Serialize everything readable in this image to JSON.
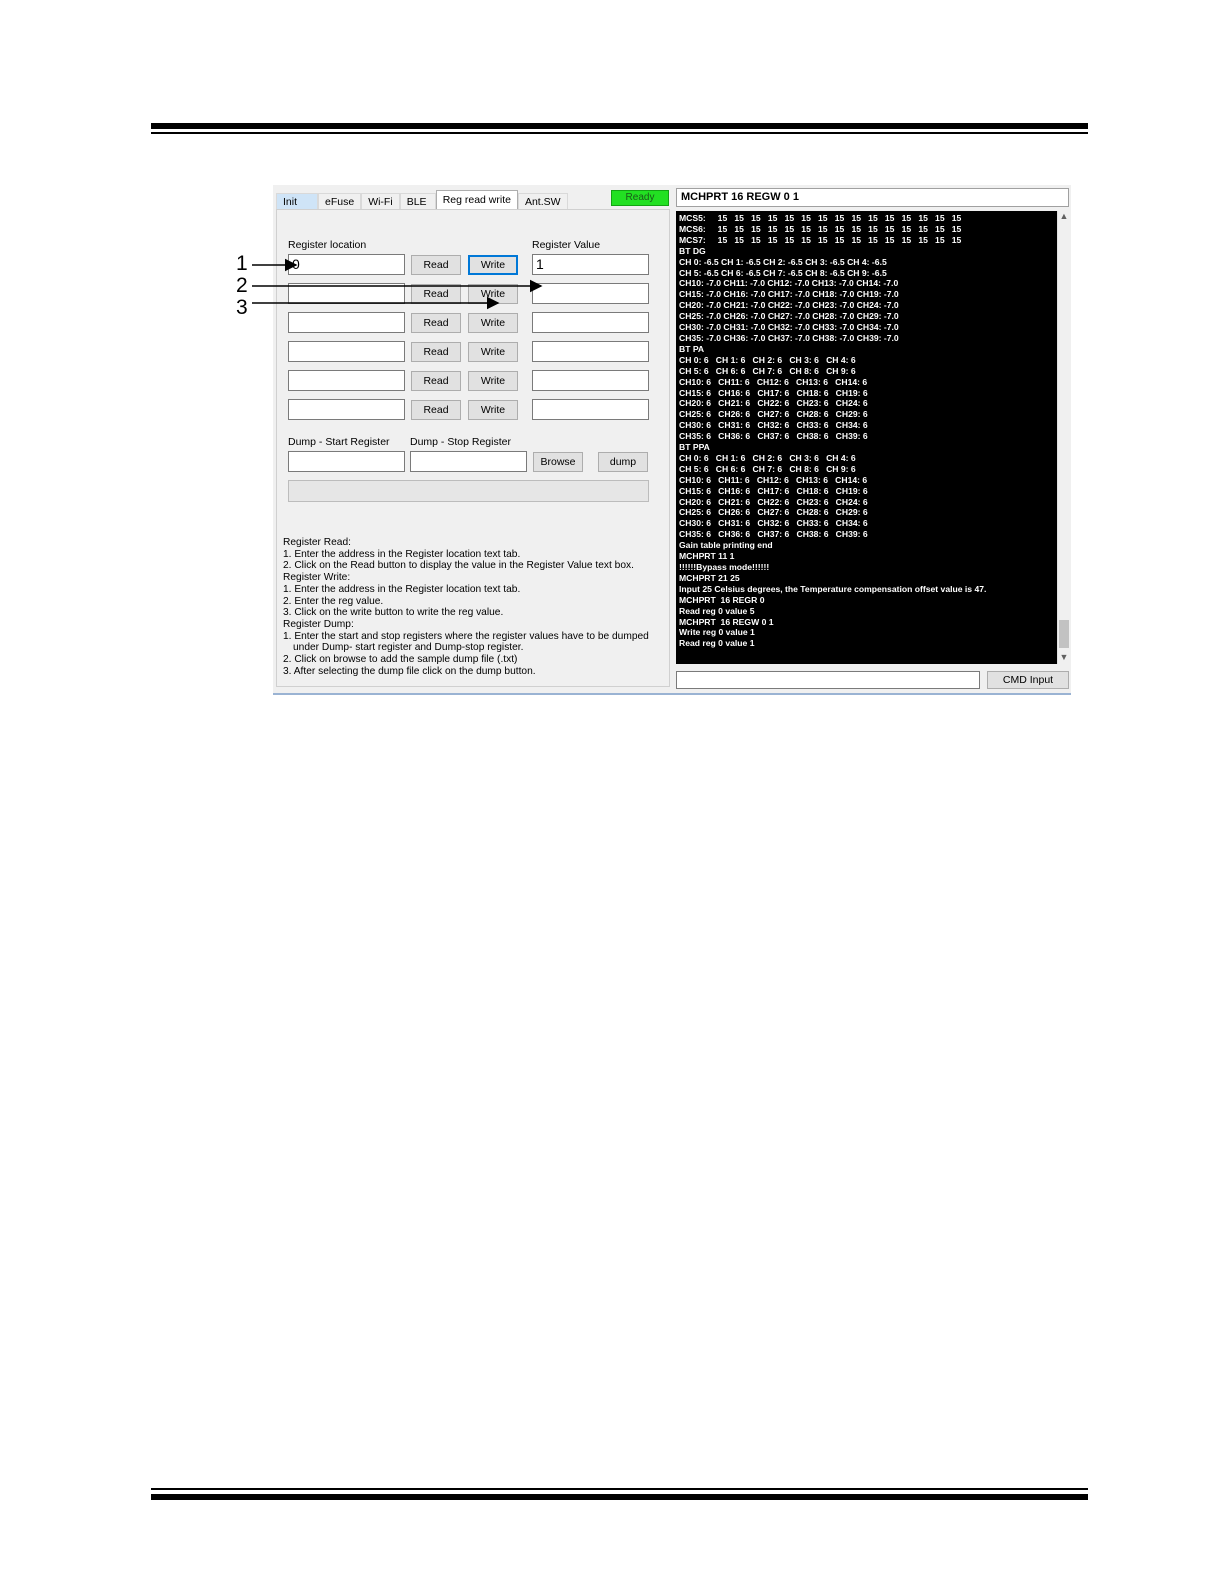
{
  "tabs": [
    "Init",
    "eFuse",
    "Wi-Fi",
    "BLE",
    "Reg read write",
    "Ant.SW"
  ],
  "status": "Ready",
  "labels": {
    "register_location": "Register location",
    "register_value": "Register Value",
    "dump_start": "Dump -  Start Register",
    "dump_stop": "Dump -  Stop Register"
  },
  "rows": [
    {
      "location": "0",
      "value": "1"
    },
    {
      "location": "",
      "value": ""
    },
    {
      "location": "",
      "value": ""
    },
    {
      "location": "",
      "value": ""
    },
    {
      "location": "",
      "value": ""
    },
    {
      "location": "",
      "value": ""
    }
  ],
  "buttons": {
    "read": "Read",
    "write": "Write",
    "browse": "Browse",
    "dump": "dump",
    "cmd_input": "CMD Input"
  },
  "help_lines": [
    "Register Read:",
    "1. Enter the address in the Register location text tab.",
    "2. Click on the Read button to display the value in the Register Value text box.",
    "Register Write:",
    "1. Enter the address in the Register location text tab.",
    "2. Enter the reg value.",
    "3. Click on the write button to write the reg value.",
    "Register Dump:",
    "1. Enter the start and stop registers where the register values have to be dumped",
    "   under Dump- start register and Dump-stop register.",
    "2.  Click on browse to add the sample dump file (.txt)",
    "3. After selecting the dump file click on the dump button."
  ],
  "command_title": "MCHPRT  16 REGW 0 1",
  "console_lines": [
    "MCS5:     15   15   15   15   15   15   15   15   15   15   15   15   15   15   15",
    "MCS6:     15   15   15   15   15   15   15   15   15   15   15   15   15   15   15",
    "MCS7:     15   15   15   15   15   15   15   15   15   15   15   15   15   15   15",
    "BT DG",
    "CH 0: -6.5 CH 1: -6.5 CH 2: -6.5 CH 3: -6.5 CH 4: -6.5",
    "CH 5: -6.5 CH 6: -6.5 CH 7: -6.5 CH 8: -6.5 CH 9: -6.5",
    "CH10: -7.0 CH11: -7.0 CH12: -7.0 CH13: -7.0 CH14: -7.0",
    "CH15: -7.0 CH16: -7.0 CH17: -7.0 CH18: -7.0 CH19: -7.0",
    "CH20: -7.0 CH21: -7.0 CH22: -7.0 CH23: -7.0 CH24: -7.0",
    "CH25: -7.0 CH26: -7.0 CH27: -7.0 CH28: -7.0 CH29: -7.0",
    "CH30: -7.0 CH31: -7.0 CH32: -7.0 CH33: -7.0 CH34: -7.0",
    "CH35: -7.0 CH36: -7.0 CH37: -7.0 CH38: -7.0 CH39: -7.0",
    "BT PA",
    "CH 0: 6   CH 1: 6   CH 2: 6   CH 3: 6   CH 4: 6",
    "CH 5: 6   CH 6: 6   CH 7: 6   CH 8: 6   CH 9: 6",
    "CH10: 6   CH11: 6   CH12: 6   CH13: 6   CH14: 6",
    "CH15: 6   CH16: 6   CH17: 6   CH18: 6   CH19: 6",
    "CH20: 6   CH21: 6   CH22: 6   CH23: 6   CH24: 6",
    "CH25: 6   CH26: 6   CH27: 6   CH28: 6   CH29: 6",
    "CH30: 6   CH31: 6   CH32: 6   CH33: 6   CH34: 6",
    "CH35: 6   CH36: 6   CH37: 6   CH38: 6   CH39: 6",
    "BT PPA",
    "CH 0: 6   CH 1: 6   CH 2: 6   CH 3: 6   CH 4: 6",
    "CH 5: 6   CH 6: 6   CH 7: 6   CH 8: 6   CH 9: 6",
    "CH10: 6   CH11: 6   CH12: 6   CH13: 6   CH14: 6",
    "CH15: 6   CH16: 6   CH17: 6   CH18: 6   CH19: 6",
    "CH20: 6   CH21: 6   CH22: 6   CH23: 6   CH24: 6",
    "CH25: 6   CH26: 6   CH27: 6   CH28: 6   CH29: 6",
    "CH30: 6   CH31: 6   CH32: 6   CH33: 6   CH34: 6",
    "CH35: 6   CH36: 6   CH37: 6   CH38: 6   CH39: 6",
    "Gain table printing end",
    "MCHPRT 11 1",
    "!!!!!!Bypass mode!!!!!!",
    "MCHPRT 21 25",
    "Input 25 Celsius degrees, the Temperature compensation offset value is 47.",
    "MCHPRT  16 REGR 0",
    "Read reg 0 value 5",
    "MCHPRT  16 REGW 0 1",
    "Write reg 0 value 1",
    "Read reg 0 value 1"
  ],
  "callouts": [
    "1",
    "2",
    "3"
  ],
  "colors": {
    "status_green": "#22e022",
    "console_bg": "#000000",
    "focus_blue": "#0078d7"
  }
}
